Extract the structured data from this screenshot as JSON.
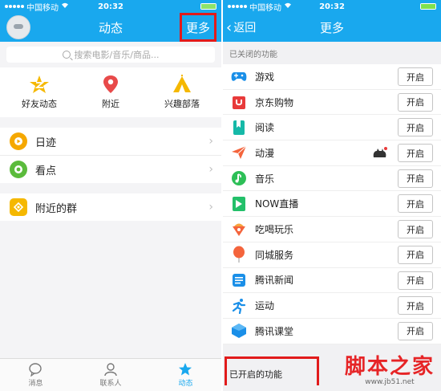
{
  "left": {
    "status": {
      "carrier": "中国移动",
      "time": "20:32"
    },
    "nav": {
      "title": "动态",
      "more": "更多"
    },
    "search": {
      "placeholder": "搜索电影/音乐/商品..."
    },
    "quick": [
      {
        "label": "好友动态",
        "icon": "friends-star-icon",
        "color": "#f5b800"
      },
      {
        "label": "附近",
        "icon": "location-pin-icon",
        "color": "#e84a4a"
      },
      {
        "label": "兴趣部落",
        "icon": "tribe-tent-icon",
        "color": "#f5b800"
      }
    ],
    "rows": [
      {
        "label": "日迹",
        "icon": "daily-play-icon",
        "color": "#f5a800"
      },
      {
        "label": "看点",
        "icon": "eye-icon",
        "color": "#5bbb3c"
      }
    ],
    "rows2": [
      {
        "label": "附近的群",
        "icon": "nearby-group-icon",
        "color": "#f5b800"
      }
    ],
    "tabs": [
      {
        "label": "消息",
        "icon": "message-icon"
      },
      {
        "label": "联系人",
        "icon": "contacts-icon"
      },
      {
        "label": "动态",
        "icon": "feed-star-icon"
      }
    ]
  },
  "right": {
    "status": {
      "carrier": "中国移动",
      "time": "20:32"
    },
    "nav": {
      "back": "返回",
      "title": "更多"
    },
    "closed_title": "已关闭的功能",
    "open_label": "开启",
    "features": [
      {
        "label": "游戏",
        "icon": "gamepad-icon",
        "color": "#1a8fe8"
      },
      {
        "label": "京东购物",
        "icon": "shopping-bag-icon",
        "color": "#e83a3a"
      },
      {
        "label": "阅读",
        "icon": "book-icon",
        "color": "#16b9a8"
      },
      {
        "label": "动漫",
        "icon": "paper-plane-icon",
        "color": "#f4643c"
      },
      {
        "label": "音乐",
        "icon": "music-icon",
        "color": "#2dbf57"
      },
      {
        "label": "NOW直播",
        "icon": "now-live-icon",
        "color": "#23c06a"
      },
      {
        "label": "吃喝玩乐",
        "icon": "food-icon",
        "color": "#f4643c"
      },
      {
        "label": "同城服务",
        "icon": "balloon-icon",
        "color": "#f4643c"
      },
      {
        "label": "腾讯新闻",
        "icon": "news-icon",
        "color": "#1a8fe8"
      },
      {
        "label": "运动",
        "icon": "running-icon",
        "color": "#1a8fe8"
      },
      {
        "label": "腾讯课堂",
        "icon": "classroom-icon",
        "color": "#1a8fe8"
      }
    ],
    "opened_title": "已开启的功能"
  },
  "watermark": {
    "name": "脚本之家",
    "url": "www.jb51.net"
  }
}
